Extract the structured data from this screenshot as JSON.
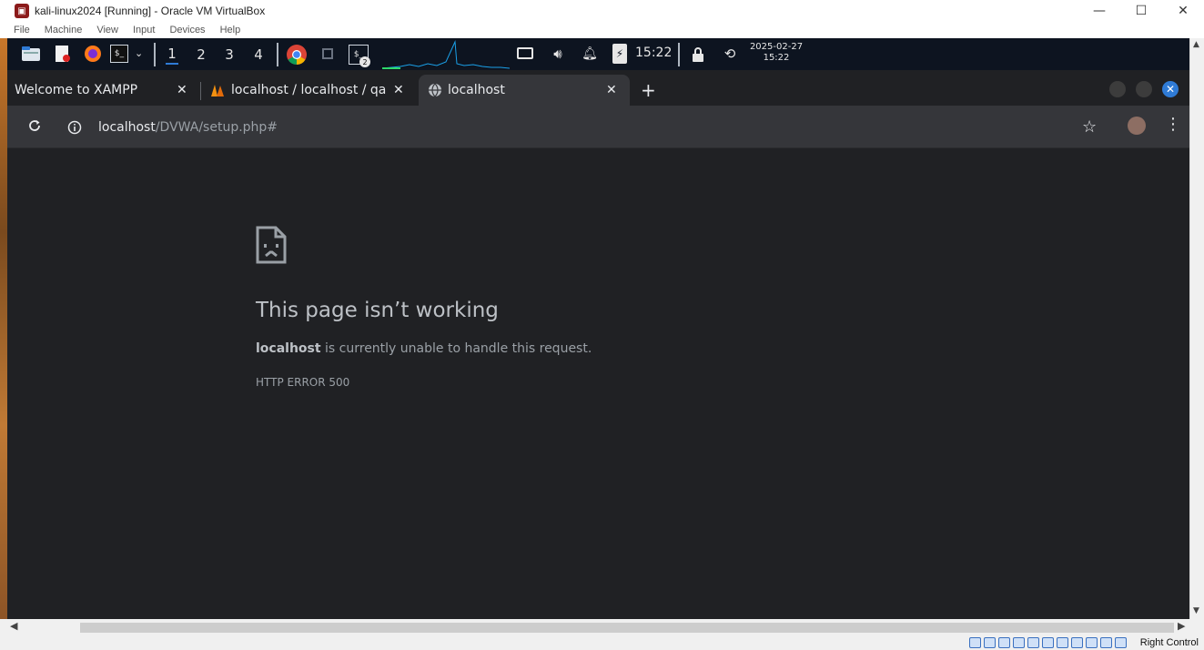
{
  "window": {
    "title": "kali-linux2024 [Running] - Oracle VM VirtualBox",
    "minimize": "—",
    "maximize": "☐",
    "close": "✕"
  },
  "vbox_menu": [
    "File",
    "Machine",
    "View",
    "Input",
    "Devices",
    "Help"
  ],
  "kali_panel": {
    "workspaces": [
      "1",
      "2",
      "3",
      "4"
    ],
    "active_workspace": "1",
    "terminal_badge": "2",
    "time": "15:22",
    "clock_date": "2025-02-27",
    "clock_time": "15:22"
  },
  "tabs": [
    {
      "label": "Welcome to XAMPP",
      "close": "✕"
    },
    {
      "label": "localhost / localhost / qa",
      "close": "✕"
    },
    {
      "label": "localhost",
      "close": "✕"
    }
  ],
  "new_tab": "+",
  "address": {
    "host": "localhost",
    "path": "/DVWA/setup.php#"
  },
  "error_page": {
    "title": "This page isn’t working",
    "host": "localhost",
    "message": " is currently unable to handle this request.",
    "code": "HTTP ERROR 500"
  },
  "statusbar": {
    "host_key": "Right Control"
  },
  "colors": {
    "page_bg": "#202124",
    "toolbar_bg": "#35363a",
    "accent": "#2f7bd6"
  }
}
